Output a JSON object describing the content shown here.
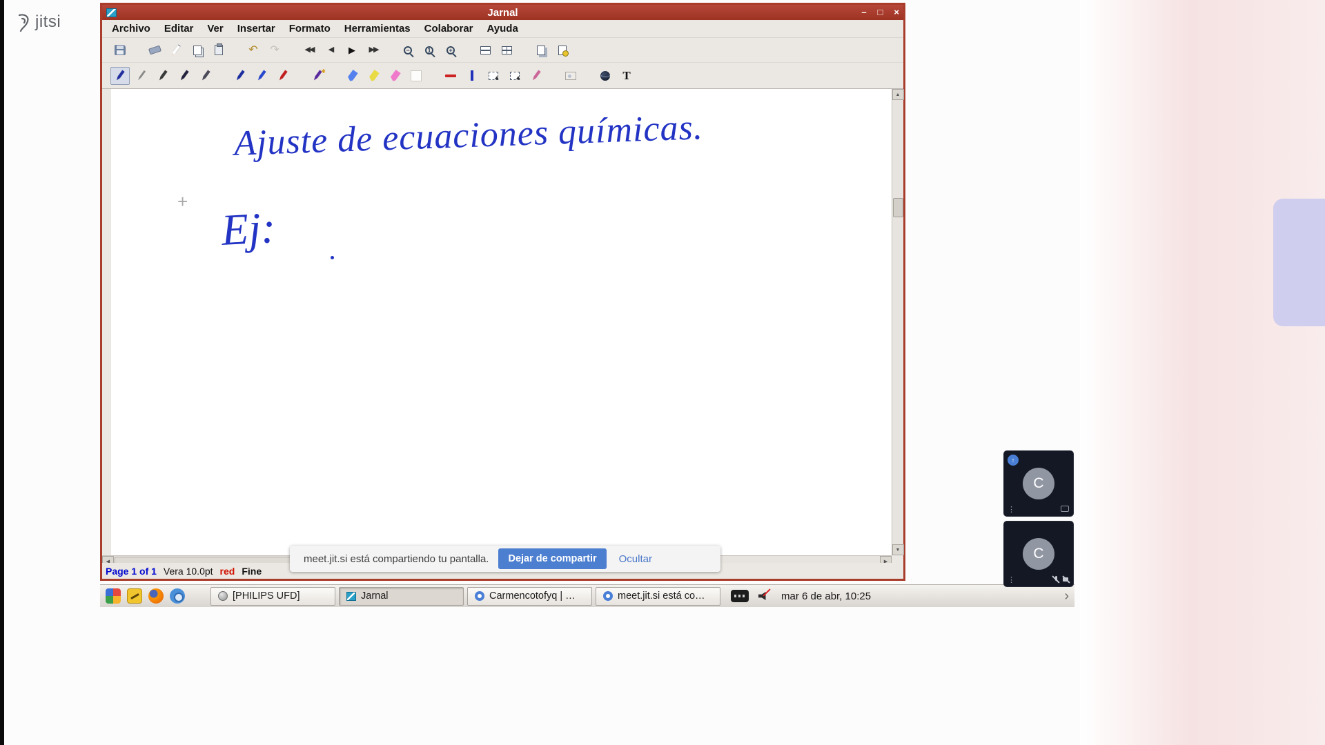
{
  "watermark": {
    "text": "jitsi"
  },
  "colors": {
    "titlebar_red": "#a93d2b",
    "ink_blue": "#2334c4",
    "notification_button_blue": "#4d7fd0",
    "tile_background": "#141824"
  },
  "window": {
    "title": "Jarnal",
    "menu": [
      "Archivo",
      "Editar",
      "Ver",
      "Insertar",
      "Formato",
      "Herramientas",
      "Colaborar",
      "Ayuda"
    ],
    "toolbar_row1": [
      "save",
      "eraser",
      "copy-page",
      "copy",
      "paste",
      "undo",
      "redo",
      "first-page",
      "previous-page",
      "next-page",
      "last-page",
      "zoom-out",
      "zoom-reset",
      "zoom-in",
      "single-page-view",
      "grid-view",
      "duplicate-page",
      "page-setup"
    ],
    "toolbar_row2": [
      "pen-blue",
      "pen-fine",
      "pen-black",
      "pen-dark",
      "pen-double",
      "pen-navy",
      "pen-royal",
      "pen-red",
      "pen-favorite",
      "highlighter-blue",
      "highlighter-yellow",
      "highlighter-pink",
      "blank-swatch",
      "ruled-line",
      "text-caret",
      "select-rectangle",
      "select-region",
      "stroke-eraser",
      "insert-image",
      "web-link",
      "text-tool"
    ]
  },
  "glyphs": {
    "minimize": "–",
    "maximize": "□",
    "close": "×",
    "undo": "↶",
    "redo": "↷",
    "first": "◀◀",
    "previous": "◀",
    "next": "▶",
    "last": "▶▶",
    "zoom_out": "−",
    "zoom_reset": "1",
    "zoom_in": "+",
    "text_tool": "T",
    "favorite_star": "✱",
    "scroll_up": "▲",
    "scroll_down": "▼",
    "scroll_left": "◀",
    "scroll_right": "▶",
    "dots": "⋮",
    "chevron": "›",
    "speaker_arrow": "↑",
    "crosshair": "+"
  },
  "canvas": {
    "title_line": "Ajuste de ecuaciones químicas.",
    "example_line": "Ej:"
  },
  "statusbar": {
    "page": "Page 1 of 1",
    "font": "Vera 10.0pt",
    "pen_color": "red",
    "pen_width": "Fine"
  },
  "notification": {
    "message": "meet.jit.si está compartiendo tu pantalla.",
    "stop": "Dejar de compartir",
    "hide": "Ocultar"
  },
  "taskbar": {
    "tasks": [
      {
        "label": "[PHILIPS UFD]"
      },
      {
        "label": "Jarnal"
      },
      {
        "label": "Carmencotofyq | …"
      },
      {
        "label": "meet.jit.si está co…"
      }
    ],
    "clock": "mar 6 de abr, 10:25"
  },
  "participants": [
    {
      "initial": "C"
    },
    {
      "initial": "C"
    }
  ]
}
